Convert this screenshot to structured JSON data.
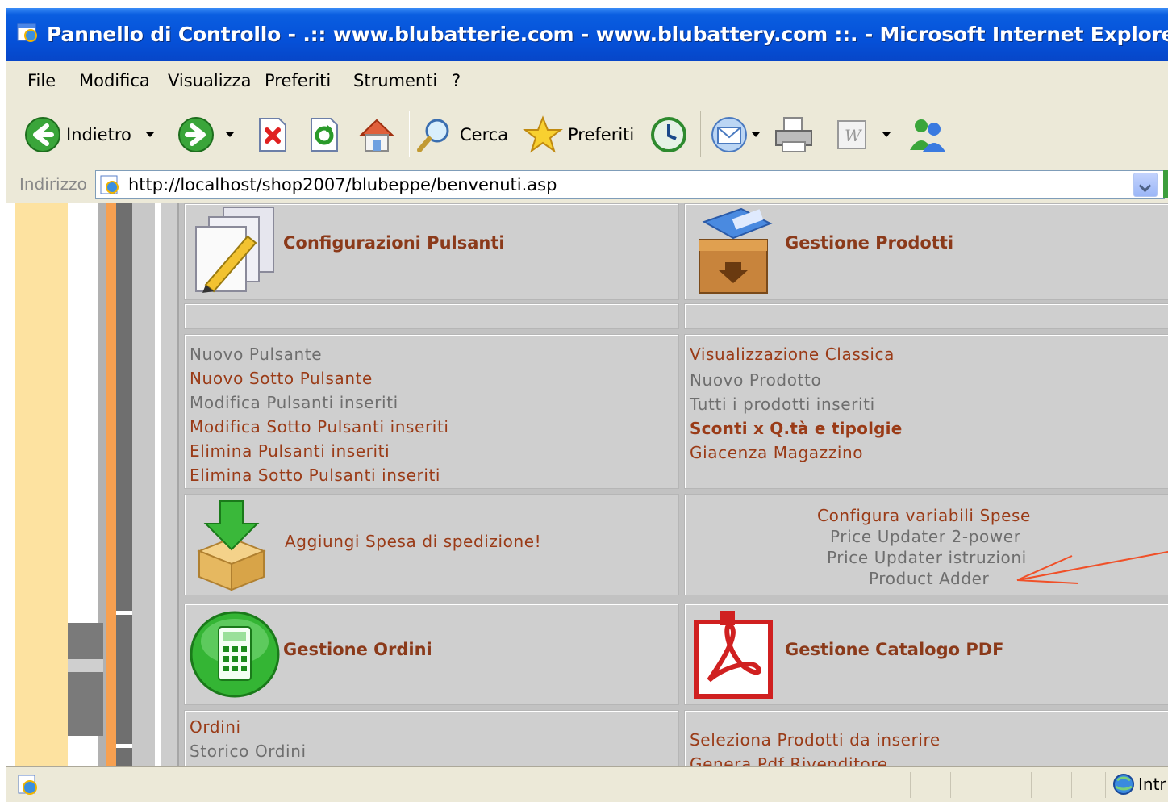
{
  "window": {
    "title": "Pannello di Controllo - .:: www.blubatterie.com - www.blubattery.com ::. - Microsoft Internet Explorer"
  },
  "menubar": {
    "items": [
      "File",
      "Modifica",
      "Visualizza",
      "Preferiti",
      "Strumenti",
      "?"
    ]
  },
  "toolbar": {
    "back_label": "Indietro",
    "search_label": "Cerca",
    "favorites_label": "Preferiti"
  },
  "address": {
    "label": "Indirizzo",
    "url": "http://localhost/shop2007/blubeppe/benvenuti.asp"
  },
  "sections": {
    "pulsanti": {
      "heading": "Configurazioni Pulsanti",
      "links": [
        "Nuovo Pulsante",
        "Nuovo Sotto Pulsante",
        "Modifica Pulsanti inseriti",
        "Modifica Sotto Pulsanti inseriti",
        "Elimina Pulsanti inseriti",
        "Elimina Sotto Pulsanti inseriti"
      ]
    },
    "prodotti": {
      "heading": "Gestione Prodotti",
      "links": [
        "Visualizzazione Classica",
        "Nuovo Prodotto",
        "Tutti i prodotti inseriti",
        "Sconti x Q.tà e tipolgie",
        "Giacenza Magazzino"
      ]
    },
    "spedizione": {
      "label": "Aggiungi Spesa di spedizione!"
    },
    "spese": {
      "links": [
        "Configura variabili Spese",
        "Price Updater 2-power",
        "Price Updater istruzioni",
        "Product Adder"
      ]
    },
    "ordini": {
      "heading": "Gestione Ordini",
      "links": [
        "Ordini",
        "Storico Ordini"
      ]
    },
    "catalogo": {
      "heading": "Gestione Catalogo PDF",
      "links": [
        "Seleziona Prodotti da inserire",
        "Genera Pdf Rivenditore"
      ]
    }
  },
  "statusbar": {
    "zone_label": "Intr"
  },
  "colors": {
    "link_dark": "#9a3b17",
    "link_grey": "#6e6e6e",
    "heading": "#8b3a1a",
    "panel_bg": "#cfcfcf",
    "titlebar": "#0551d9"
  }
}
